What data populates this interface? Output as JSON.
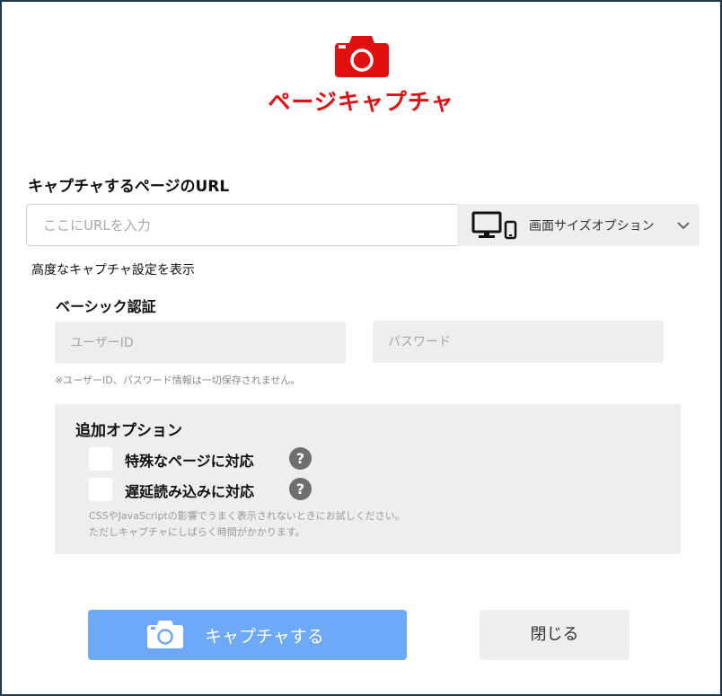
{
  "header": {
    "icon": "camera-icon",
    "title": "ページキャプチャ",
    "brand_color": "#e20f0f"
  },
  "url_section": {
    "label": "キャプチャするページのURL",
    "placeholder": "ここにURLを入力",
    "size_option": {
      "icon": "devices-icon",
      "label": "画面サイズオプション",
      "chevron": "chevron-down-icon"
    }
  },
  "advanced_link": "高度なキャプチャ設定を表示",
  "basic_auth": {
    "title": "ベーシック認証",
    "user_placeholder": "ユーザーID",
    "password_placeholder": "パスワード",
    "note": "※ユーザーID、パスワード情報は一切保存されません。"
  },
  "extra_options": {
    "title": "追加オプション",
    "items": [
      {
        "label": "特殊なページに対応",
        "help": "?"
      },
      {
        "label": "遅延読み込みに対応",
        "help": "?"
      }
    ],
    "note_line1": "CSSやJavaScriptの影響でうまく表示されないときにお試しください。",
    "note_line2": "ただしキャプチャにしばらく時間がかかります。"
  },
  "footer": {
    "capture_label": "キャプチャする",
    "close_label": "閉じる",
    "accent": "#6ea9f7"
  }
}
